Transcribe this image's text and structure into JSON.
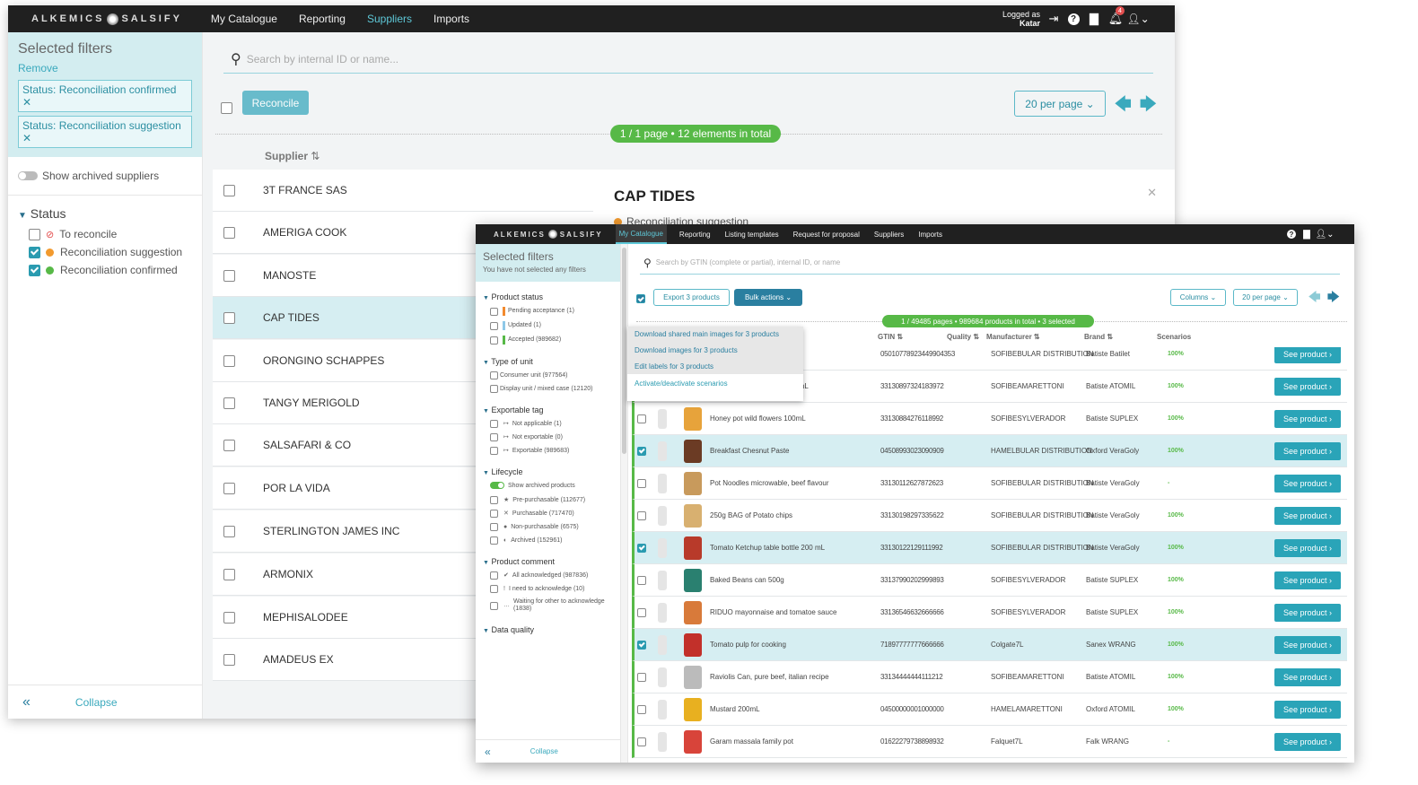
{
  "back": {
    "brand": "ALKEMICS",
    "brand2": "SALSIFY",
    "nav": [
      "My Catalogue",
      "Reporting",
      "Suppliers",
      "Imports"
    ],
    "logged_as": "Logged as",
    "user": "Katar",
    "notif_count": "4",
    "sidebar": {
      "title": "Selected filters",
      "remove": "Remove",
      "chips": [
        "Status: Reconciliation confirmed",
        "Status: Reconciliation suggestion"
      ],
      "show_archived": "Show archived suppliers",
      "status_title": "Status",
      "status_items": [
        {
          "label": "To reconcile",
          "checked": false,
          "color": "#e35050"
        },
        {
          "label": "Reconciliation suggestion",
          "checked": true,
          "color": "#f29a2e"
        },
        {
          "label": "Reconciliation confirmed",
          "checked": true,
          "color": "#57b947"
        }
      ],
      "collapse": "Collapse"
    },
    "search_placeholder": "Search by internal ID or name...",
    "reconcile": "Reconcile",
    "per_page": "20 per page",
    "pill": "1 / 1 page  •  12 elements in total",
    "col_supplier": "Supplier",
    "suppliers": [
      "3T FRANCE SAS",
      "AMERIGA COOK",
      "MANOSTE",
      "CAP TIDES",
      "ORONGINO SCHAPPES",
      "TANGY MERIGOLD",
      "SALSAFARI & CO",
      "POR LA VIDA",
      "STERLINGTON JAMES INC",
      "ARMONIX",
      "MEPHISALODEE",
      "AMADEUS EX"
    ],
    "detail_title": "CAP TIDES",
    "detail_status": "Reconciliation suggestion"
  },
  "front": {
    "nav": [
      "My Catalogue",
      "Reporting",
      "Listing templates",
      "Request for proposal",
      "Suppliers",
      "Imports"
    ],
    "sidebar": {
      "title": "Selected filters",
      "subtitle": "You have not selected any filters",
      "groups": [
        {
          "title": "Product status",
          "items": [
            {
              "label": "Pending acceptance (1)",
              "color": "#f28a2e"
            },
            {
              "label": "Updated (1)",
              "color": "#8ec8e8"
            },
            {
              "label": "Accepted (989682)",
              "color": "#57b947"
            }
          ]
        },
        {
          "title": "Type of unit",
          "items": [
            {
              "label": "Consumer unit (977564)"
            },
            {
              "label": "Display unit / mixed case (12120)"
            }
          ]
        },
        {
          "title": "Exportable tag",
          "items": [
            {
              "label": "Not applicable (1)",
              "icon": "↦"
            },
            {
              "label": "Not exportable (0)",
              "icon": "↦"
            },
            {
              "label": "Exportable (989683)",
              "icon": "↦"
            }
          ]
        },
        {
          "title": "Lifecycle",
          "toggle": "Show archived products",
          "items": [
            {
              "label": "Pre-purchasable (112677)",
              "icon": "★"
            },
            {
              "label": "Purchasable (717470)",
              "icon": "✕"
            },
            {
              "label": "Non-purchasable (6575)",
              "icon": "●"
            },
            {
              "label": "Archived (152961)",
              "icon": "◐"
            }
          ]
        },
        {
          "title": "Product comment",
          "items": [
            {
              "label": "All acknowledged (987836)",
              "icon": "✔"
            },
            {
              "label": "I need to acknowledge (10)",
              "icon": "!"
            },
            {
              "label": "Waiting for other to acknowledge (1838)",
              "icon": "…"
            }
          ]
        },
        {
          "title": "Data quality",
          "items": []
        }
      ],
      "collapse": "Collapse"
    },
    "search_placeholder": "Search by GTIN (complete or partial), internal ID, or name",
    "export": "Export 3 products",
    "bulk": "Bulk actions",
    "columns": "Columns",
    "per_page": "20 per page",
    "dropdown": [
      "Download shared main images for 3 products",
      "Download images for 3 products",
      "Edit labels for 3 products",
      "Activate/deactivate scenarios"
    ],
    "pill": "1 / 49485 pages  •  989684 products in total  •  3 selected",
    "cols": {
      "gtin": "GTIN",
      "quality": "Quality",
      "manufacturer": "Manufacturer",
      "brand": "Brand",
      "scenarios": "Scenarios"
    },
    "see": "See product",
    "rows": [
      {
        "name": "",
        "gtin": "05010778923449904353",
        "man": "SOFIBEBULAR DISTRIBUTION",
        "brand": "Batiste Batilet",
        "pct": "100%",
        "checked": false
      },
      {
        "name": "Dark Sauce for cooking 200mL",
        "gtin": "33130897324183972",
        "man": "SOFIBEAMARETTONI",
        "brand": "Batiste ATOMIL",
        "pct": "100%",
        "checked": false
      },
      {
        "name": "Honey pot wild flowers 100mL",
        "gtin": "33130884276118992",
        "man": "SOFIBESYLVERADOR",
        "brand": "Batiste SUPLEX",
        "pct": "100%",
        "checked": false
      },
      {
        "name": "Breakfast Chesnut Paste",
        "gtin": "04508993023090909",
        "man": "HAMELBULAR DISTRIBUTION",
        "brand": "Oxford VeraGoly",
        "pct": "100%",
        "checked": true
      },
      {
        "name": "Pot Noodles microwable, beef flavour",
        "gtin": "33130112627872623",
        "man": "SOFIBEBULAR DISTRIBUTION",
        "brand": "Batiste VeraGoly",
        "pct": "-",
        "checked": false
      },
      {
        "name": "250g BAG of Potato chips",
        "gtin": "33130198297335622",
        "man": "SOFIBEBULAR DISTRIBUTION",
        "brand": "Batiste VeraGoly",
        "pct": "100%",
        "checked": false
      },
      {
        "name": "Tomato Ketchup table bottle 200 mL",
        "gtin": "33130122129111992",
        "man": "SOFIBEBULAR DISTRIBUTION",
        "brand": "Batiste VeraGoly",
        "pct": "100%",
        "checked": true
      },
      {
        "name": "Baked Beans can 500g",
        "gtin": "33137990202999893",
        "man": "SOFIBESYLVERADOR",
        "brand": "Batiste SUPLEX",
        "pct": "100%",
        "checked": false
      },
      {
        "name": "RIDUO mayonnaise and tomatoe sauce",
        "gtin": "33136546632666666",
        "man": "SOFIBESYLVERADOR",
        "brand": "Batiste SUPLEX",
        "pct": "100%",
        "checked": false
      },
      {
        "name": "Tomato pulp for cooking",
        "gtin": "71897777777666666",
        "man": "Colgate7L",
        "brand": "Sanex WRANG",
        "pct": "100%",
        "checked": true
      },
      {
        "name": "Raviolis Can, pure beef, italian recipe",
        "gtin": "33134444444111212",
        "man": "SOFIBEAMARETTONI",
        "brand": "Batiste ATOMIL",
        "pct": "100%",
        "checked": false
      },
      {
        "name": "Mustard 200mL",
        "gtin": "04500000001000000",
        "man": "HAMELAMARETTONI",
        "brand": "Oxford ATOMIL",
        "pct": "100%",
        "checked": false
      },
      {
        "name": "Garam massala family pot",
        "gtin": "01622279738898932",
        "man": "Falquet7L",
        "brand": "Falk WRANG",
        "pct": "-",
        "checked": false
      }
    ]
  }
}
